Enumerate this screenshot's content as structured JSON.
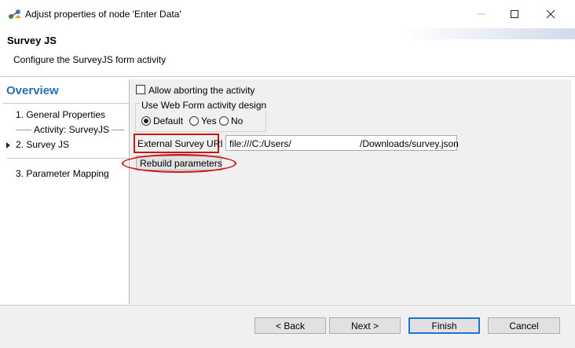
{
  "window": {
    "title": "Adjust properties of node 'Enter Data'",
    "icons": {
      "app": "knime-node-icon",
      "minimize": "minimize-icon",
      "maximize": "maximize-icon",
      "close": "close-icon"
    }
  },
  "header": {
    "title": "Survey JS",
    "description": "Configure the SurveyJS form activity"
  },
  "sidebar": {
    "title": "Overview",
    "items": [
      {
        "label": "1. General Properties"
      },
      {
        "label": "Activity: SurveyJS"
      },
      {
        "label": "2. Survey JS",
        "selected": true
      },
      {
        "label": "3. Parameter Mapping"
      }
    ]
  },
  "form": {
    "allow_aborting": {
      "label": "Allow aborting the activity",
      "checked": false
    },
    "web_form_design": {
      "label": "Use Web Form activity design",
      "options": [
        {
          "label": "Default",
          "selected": true
        },
        {
          "label": "Yes",
          "selected": false
        },
        {
          "label": "No",
          "selected": false
        }
      ]
    },
    "external_uri": {
      "label": "External Survey URI",
      "value_start": "file:///C:/Users/",
      "value_end": "/Downloads/survey.json"
    },
    "rebuild_button": "Rebuild parameters"
  },
  "footer": {
    "back": "< Back",
    "next": "Next >",
    "finish": "Finish",
    "cancel": "Cancel"
  },
  "colors": {
    "accent": "#2a6db5",
    "highlight": "#d01010",
    "default_button": "#1e74d3"
  }
}
